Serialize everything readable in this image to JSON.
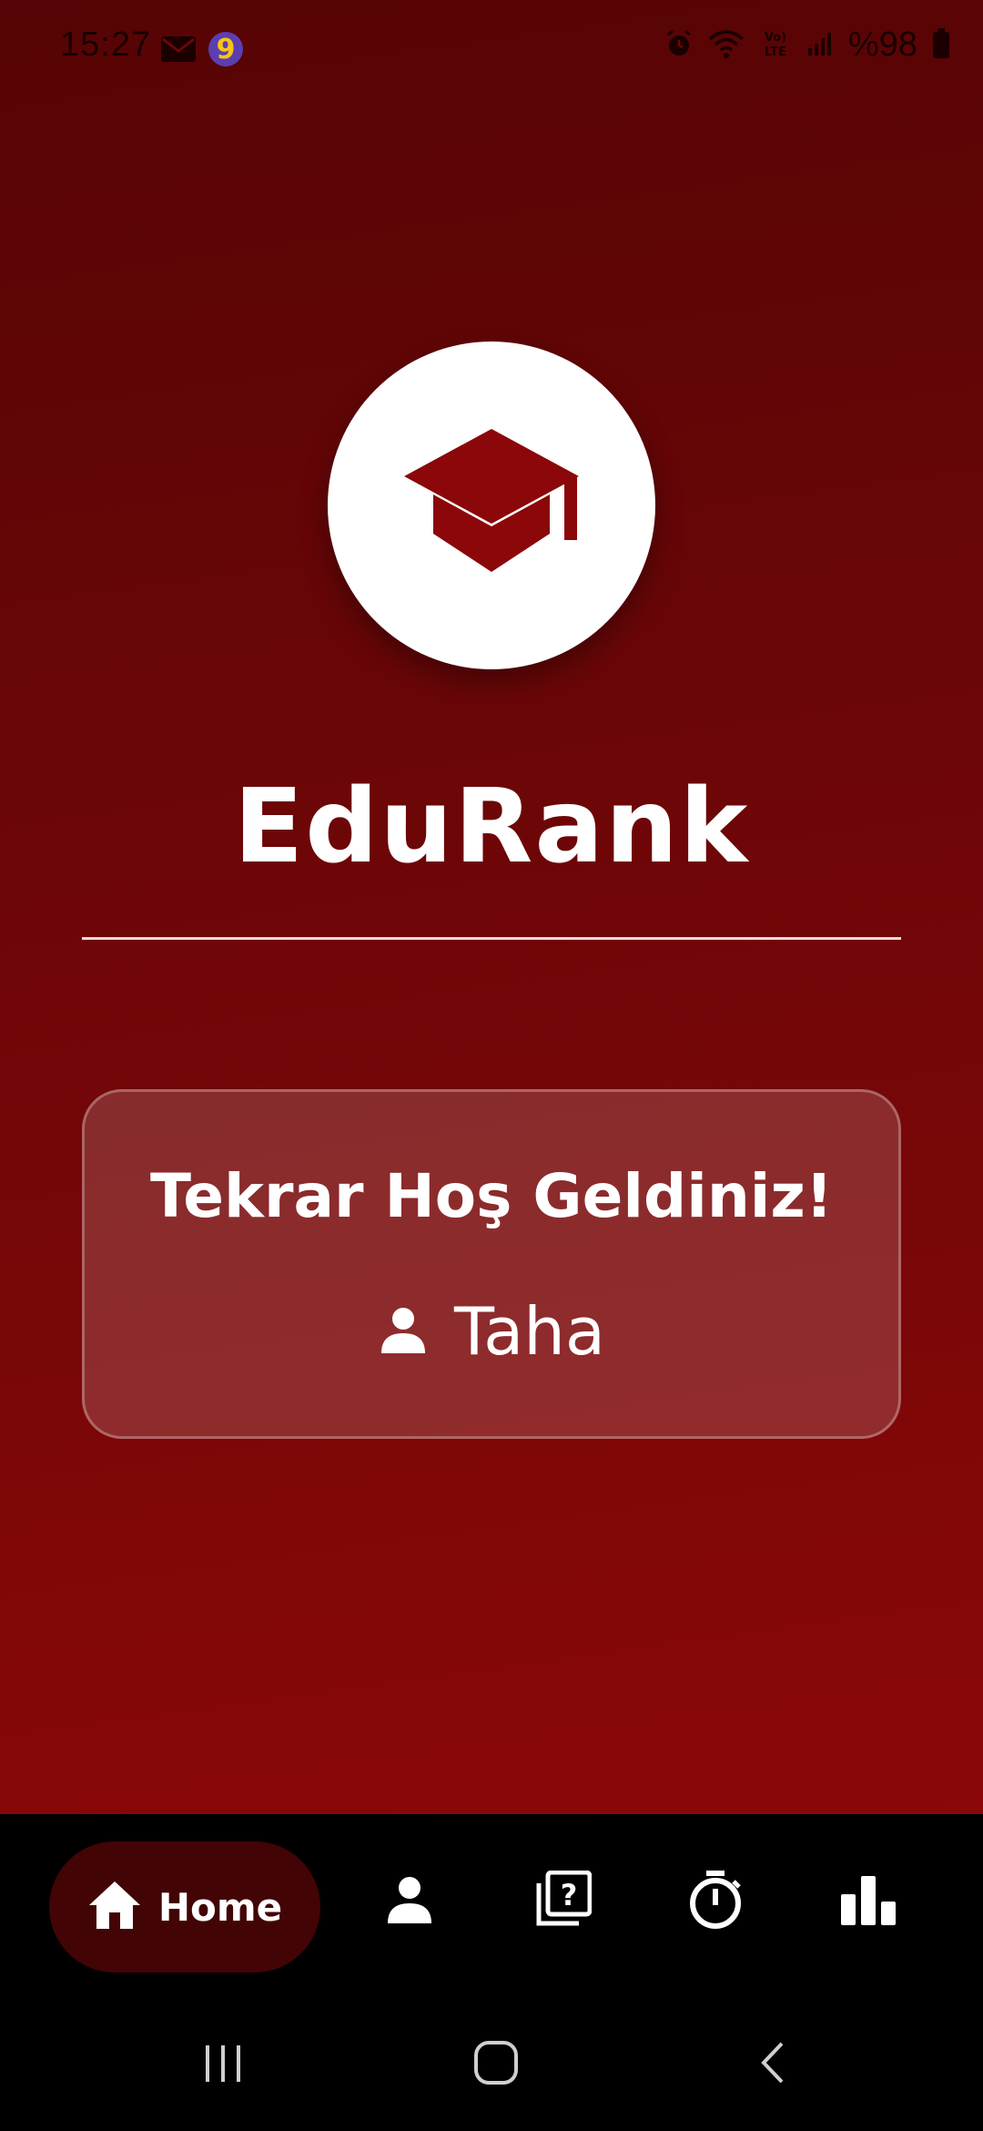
{
  "status_bar": {
    "time": "15:27",
    "battery": "%98",
    "left_icons": [
      "gmail-icon",
      "app-notification-icon"
    ],
    "right_icons": [
      "alarm-icon",
      "wifi-icon",
      "volte-icon",
      "signal-icon",
      "battery-icon"
    ]
  },
  "app": {
    "logo_icon": "graduation-cap-icon",
    "title": "EduRank"
  },
  "welcome": {
    "title": "Tekrar Hoş Geldiniz!",
    "user_icon": "person-icon",
    "username": "Taha"
  },
  "bottom_nav": {
    "items": [
      {
        "label": "Home",
        "icon": "home-icon",
        "active": true
      },
      {
        "label": "",
        "icon": "profile-icon",
        "active": false
      },
      {
        "label": "",
        "icon": "quiz-icon",
        "active": false
      },
      {
        "label": "",
        "icon": "timer-icon",
        "active": false
      },
      {
        "label": "",
        "icon": "leaderboard-icon",
        "active": false
      }
    ]
  },
  "colors": {
    "primary": "#8b0709",
    "background_top": "#560405",
    "nav_active_bg": "#420405",
    "card_text": "#ffffff"
  }
}
